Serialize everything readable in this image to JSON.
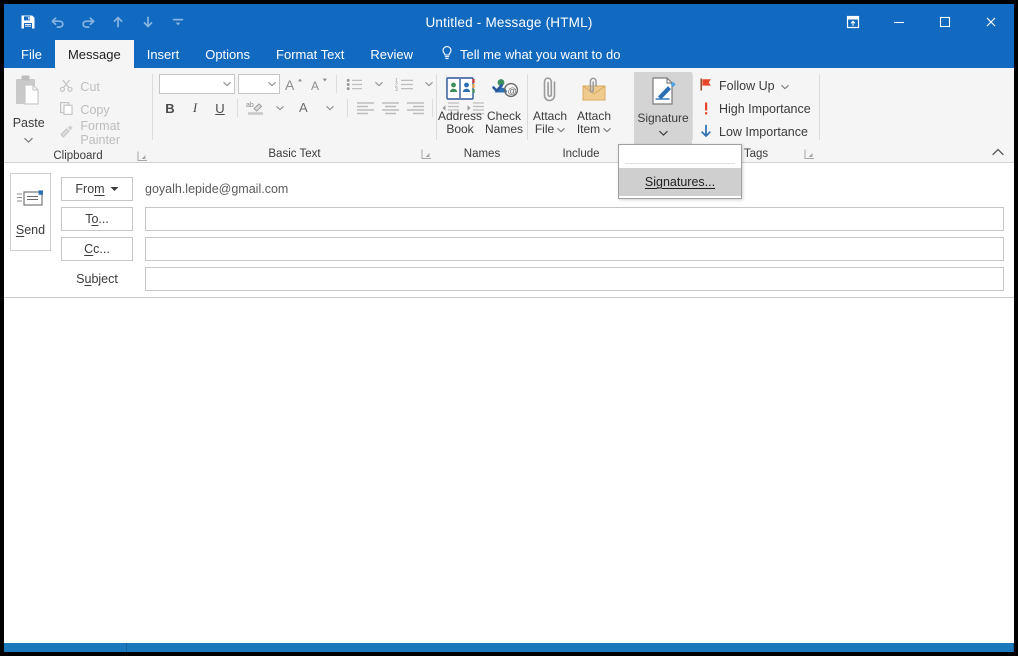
{
  "window": {
    "title": "Untitled  -  Message (HTML)",
    "accent_color": "#1169c0",
    "ribbon_bg": "#f5f5f5"
  },
  "quick_access": [
    {
      "name": "save-icon",
      "tooltip": "Save"
    },
    {
      "name": "undo-icon",
      "tooltip": "Undo"
    },
    {
      "name": "redo-icon",
      "tooltip": "Redo"
    },
    {
      "name": "previous-item-icon",
      "tooltip": "Previous Item"
    },
    {
      "name": "next-item-icon",
      "tooltip": "Next Item"
    },
    {
      "name": "customize-quick-access-toolbar-icon",
      "tooltip": "Customize Quick Access Toolbar"
    }
  ],
  "window_controls": [
    {
      "name": "ribbon-display-options-icon",
      "label": "Ribbon Display Options"
    },
    {
      "name": "minimize-button",
      "label": "Minimize"
    },
    {
      "name": "maximize-button",
      "label": "Maximize"
    },
    {
      "name": "close-button",
      "label": "Close"
    }
  ],
  "tabs": [
    {
      "label": "File",
      "active": false
    },
    {
      "label": "Message",
      "active": true
    },
    {
      "label": "Insert",
      "active": false
    },
    {
      "label": "Options",
      "active": false
    },
    {
      "label": "Format Text",
      "active": false
    },
    {
      "label": "Review",
      "active": false
    }
  ],
  "tell_me": {
    "label": "Tell me what you want to do",
    "icon": "lightbulb-icon"
  },
  "ribbon": {
    "groups": [
      {
        "label": "Clipboard",
        "has_dialog_launcher": true
      },
      {
        "label": "Basic Text",
        "has_dialog_launcher": true
      },
      {
        "label": "Names",
        "has_dialog_launcher": false
      },
      {
        "label": "Include",
        "has_dialog_launcher": false
      },
      {
        "label": "Tags",
        "has_dialog_launcher": true
      }
    ],
    "clipboard": {
      "paste_label": "Paste",
      "cut_label": "Cut",
      "copy_label": "Copy",
      "format_painter_label": "Format Painter"
    },
    "basic_text": {
      "font_name_value": "",
      "font_size_value": "",
      "grow_font_label": "A",
      "shrink_font_label": "A",
      "bold_label": "B",
      "italic_label": "I",
      "underline_label": "U",
      "font_color_label": "A"
    },
    "names": {
      "address_book_line1": "Address",
      "address_book_line2": "Book",
      "check_names_line1": "Check",
      "check_names_line2": "Names"
    },
    "include": {
      "attach_file_line1": "Attach",
      "attach_file_line2": "File",
      "attach_item_line1": "Attach",
      "attach_item_line2": "Item",
      "signature_label": "Signature"
    },
    "tags": {
      "follow_up_label": "Follow Up",
      "high_importance_label": "High Importance",
      "low_importance_label": "Low Importance"
    },
    "collapse_ribbon_label": "Collapse the Ribbon"
  },
  "signature_menu": {
    "open": true,
    "items": [
      {
        "label": "Signatures...",
        "highlighted": true
      }
    ]
  },
  "compose": {
    "send_label": "Send",
    "from_label": "From",
    "from_value": "goyalh.lepide@gmail.com",
    "to_label": "To...",
    "to_value": "",
    "cc_label": "Cc...",
    "cc_value": "",
    "subject_label": "Subject",
    "subject_value": "",
    "body_value": ""
  }
}
